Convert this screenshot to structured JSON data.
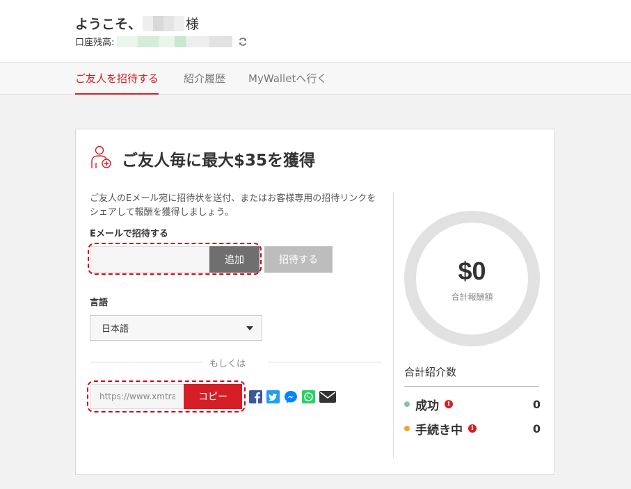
{
  "header": {
    "welcome_prefix": "ようこそ、",
    "welcome_suffix": "様",
    "balance_label": "口座残高:"
  },
  "tabs": [
    {
      "label": "ご友人を招待する",
      "active": true
    },
    {
      "label": "紹介履歴",
      "active": false
    },
    {
      "label": "MyWalletへ行く",
      "active": false
    }
  ],
  "card": {
    "title": "ご友人毎に最大$35を獲得",
    "description": "ご友人のEメール宛に招待状を送付、またはお客様専用の招待リンクをシェアして報酬を獲得しましょう。",
    "email_label": "Eメールで招待する",
    "email_value": "",
    "add_button": "追加",
    "invite_button": "招待する",
    "language_label": "言語",
    "language_selected": "日本語",
    "or_text": "もしくは",
    "link_value": "https://www.xmtra",
    "copy_button": "コピー",
    "share_icons": [
      "facebook-icon",
      "twitter-icon",
      "messenger-icon",
      "whatsapp-icon",
      "email-icon"
    ]
  },
  "rewards": {
    "amount": "$0",
    "amount_label": "合計報酬額",
    "total_referrals_label": "合計紹介数",
    "stats": [
      {
        "label": "成功",
        "count": "0",
        "color": "#8dc49a"
      },
      {
        "label": "手続き中",
        "count": "0",
        "color": "#f0a52a"
      }
    ]
  },
  "colors": {
    "accent": "#d51f26",
    "add_button": "#6f6f6f",
    "invite_button": "#bdbdbd"
  }
}
